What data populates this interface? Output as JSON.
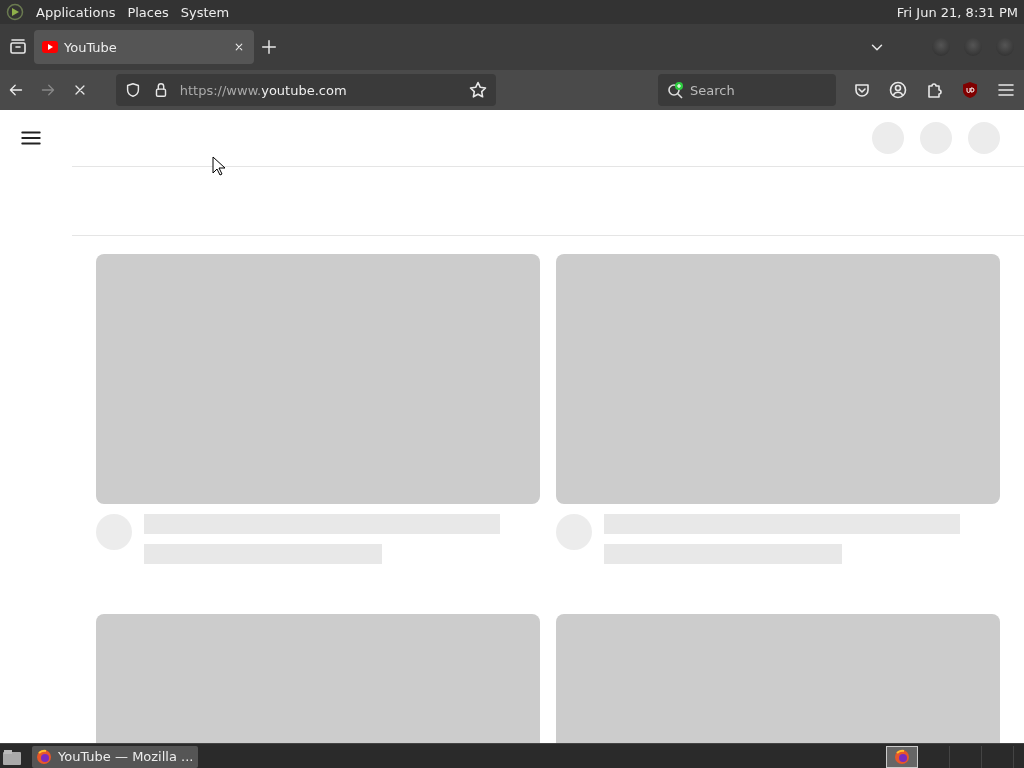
{
  "top_panel": {
    "menus": [
      "Applications",
      "Places",
      "System"
    ],
    "clock": "Fri Jun 21,  8:31 PM"
  },
  "browser": {
    "tabs": [
      {
        "title": "YouTube",
        "selected": true
      }
    ],
    "toolbar": {
      "back_disabled": false,
      "forward_disabled": true,
      "loading": true,
      "url_scheme": "https://www.",
      "url_host": "youtube.com",
      "search_placeholder": "Search"
    }
  },
  "page": {
    "cards": [
      {
        "kind": "skeleton"
      },
      {
        "kind": "skeleton"
      },
      {
        "kind": "thumbnail_only"
      },
      {
        "kind": "thumbnail_only"
      }
    ]
  },
  "taskbar": {
    "windows": [
      {
        "title": "YouTube — Mozilla ...",
        "selected": true
      }
    ],
    "workspaces": [
      {
        "selected": true
      },
      {
        "selected": false
      },
      {
        "selected": false
      },
      {
        "selected": false
      }
    ]
  }
}
